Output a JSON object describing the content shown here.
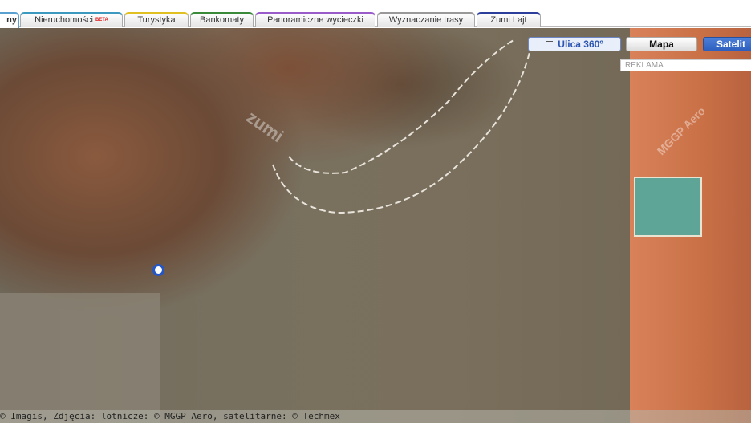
{
  "tabs": [
    {
      "label": "ny",
      "color": "#5aa0d0"
    },
    {
      "label": "Nieruchomości",
      "badge": "BETA",
      "color": "#3c9ac0"
    },
    {
      "label": "Turystyka",
      "color": "#e0c020"
    },
    {
      "label": "Bankomaty",
      "color": "#3a8a3a"
    },
    {
      "label": "Panoramiczne wycieczki",
      "color": "#9a5cc8"
    },
    {
      "label": "Wyznaczanie trasy",
      "color": "#999999"
    },
    {
      "label": "Zumi Lajt",
      "color": "#2a3e9a"
    }
  ],
  "controls": {
    "street_view": "Ulica 360º",
    "map": "Mapa",
    "satellite": "Satelit",
    "ad": "REKLAMA"
  },
  "attribution": "© Imagis, Zdjęcia: lotnicze: © MGGP Aero, satelitarne: © Techmex",
  "watermarks": {
    "zumi": "zumi",
    "mggp": "MGGP Aero"
  }
}
